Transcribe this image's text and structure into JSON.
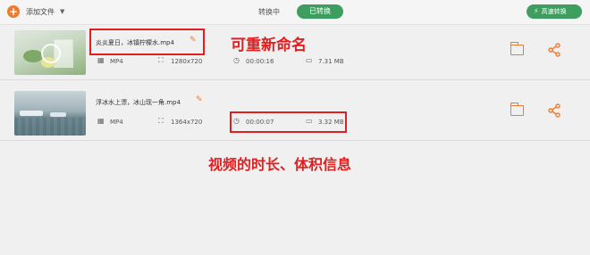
{
  "toolbar": {
    "add_label": "添加文件",
    "tab_converting": "转换中",
    "tab_converted": "已转换",
    "fast_convert": "高速转换"
  },
  "files": [
    {
      "name": "炎炎夏日，冰镇柠檬水.mp4",
      "format": "MP4",
      "resolution": "1280x720",
      "duration": "00:00:16",
      "size": "7.31 MB"
    },
    {
      "name": "浮冰水上漂，冰山现一角.mp4",
      "format": "MP4",
      "resolution": "1364x720",
      "duration": "00:00:07",
      "size": "3.32 MB"
    }
  ],
  "annotations": {
    "rename_note": "可重新命名",
    "info_note": "视频的时长、体积信息",
    "color": "#e02020"
  },
  "colors": {
    "accent_orange": "#f07b2e",
    "accent_green": "#3d9e5f"
  },
  "icons": {
    "add": "plus-circle-icon",
    "edit": "pencil-icon",
    "folder": "folder-icon",
    "share": "share-icon",
    "fast": "lightning-icon"
  }
}
